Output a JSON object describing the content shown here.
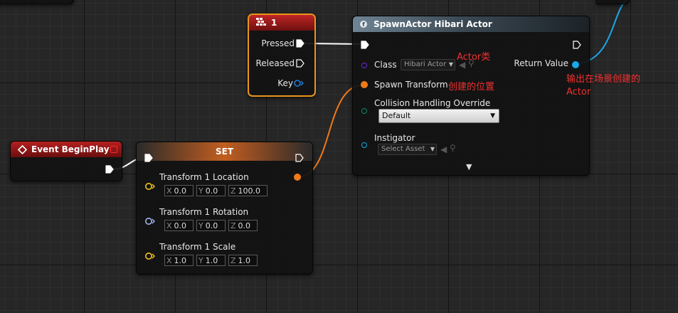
{
  "key_node": {
    "title": "1",
    "pins": {
      "pressed": "Pressed",
      "released": "Released",
      "key": "Key"
    }
  },
  "spawn_node": {
    "title": "SpawnActor Hibari Actor",
    "class_label": "Class",
    "class_value": "Hibari Actor",
    "spawn_transform_label": "Spawn Transform",
    "collision_label": "Collision Handling Override",
    "collision_value": "Default",
    "instigator_label": "Instigator",
    "instigator_value": "Select Asset",
    "return_label": "Return Value"
  },
  "event_node": {
    "title": "Event BeginPlay"
  },
  "set_node": {
    "title": "SET",
    "location": {
      "label": "Transform 1 Location",
      "x": "0.0",
      "y": "0.0",
      "z": "100.0"
    },
    "rotation": {
      "label": "Transform 1 Rotation",
      "x": "0.0",
      "y": "0.0",
      "z": "0.0"
    },
    "scale": {
      "label": "Transform 1 Scale",
      "x": "1.0",
      "y": "1.0",
      "z": "1.0"
    }
  },
  "axis_labels": {
    "x": "X",
    "y": "Y",
    "z": "Z"
  },
  "annotations": {
    "actor_class": "Actor类",
    "spawn_position": "创建的位置",
    "output_line1": "输出在场景创建的",
    "output_line2": "Actor"
  },
  "colors": {
    "exec_wire": "#ffffff",
    "transform_wire": "#f07a18",
    "object_wire": "#1aa8e8",
    "key_header": "#a01818",
    "key_outline": "#e8961c",
    "annotation": "#f03030"
  }
}
